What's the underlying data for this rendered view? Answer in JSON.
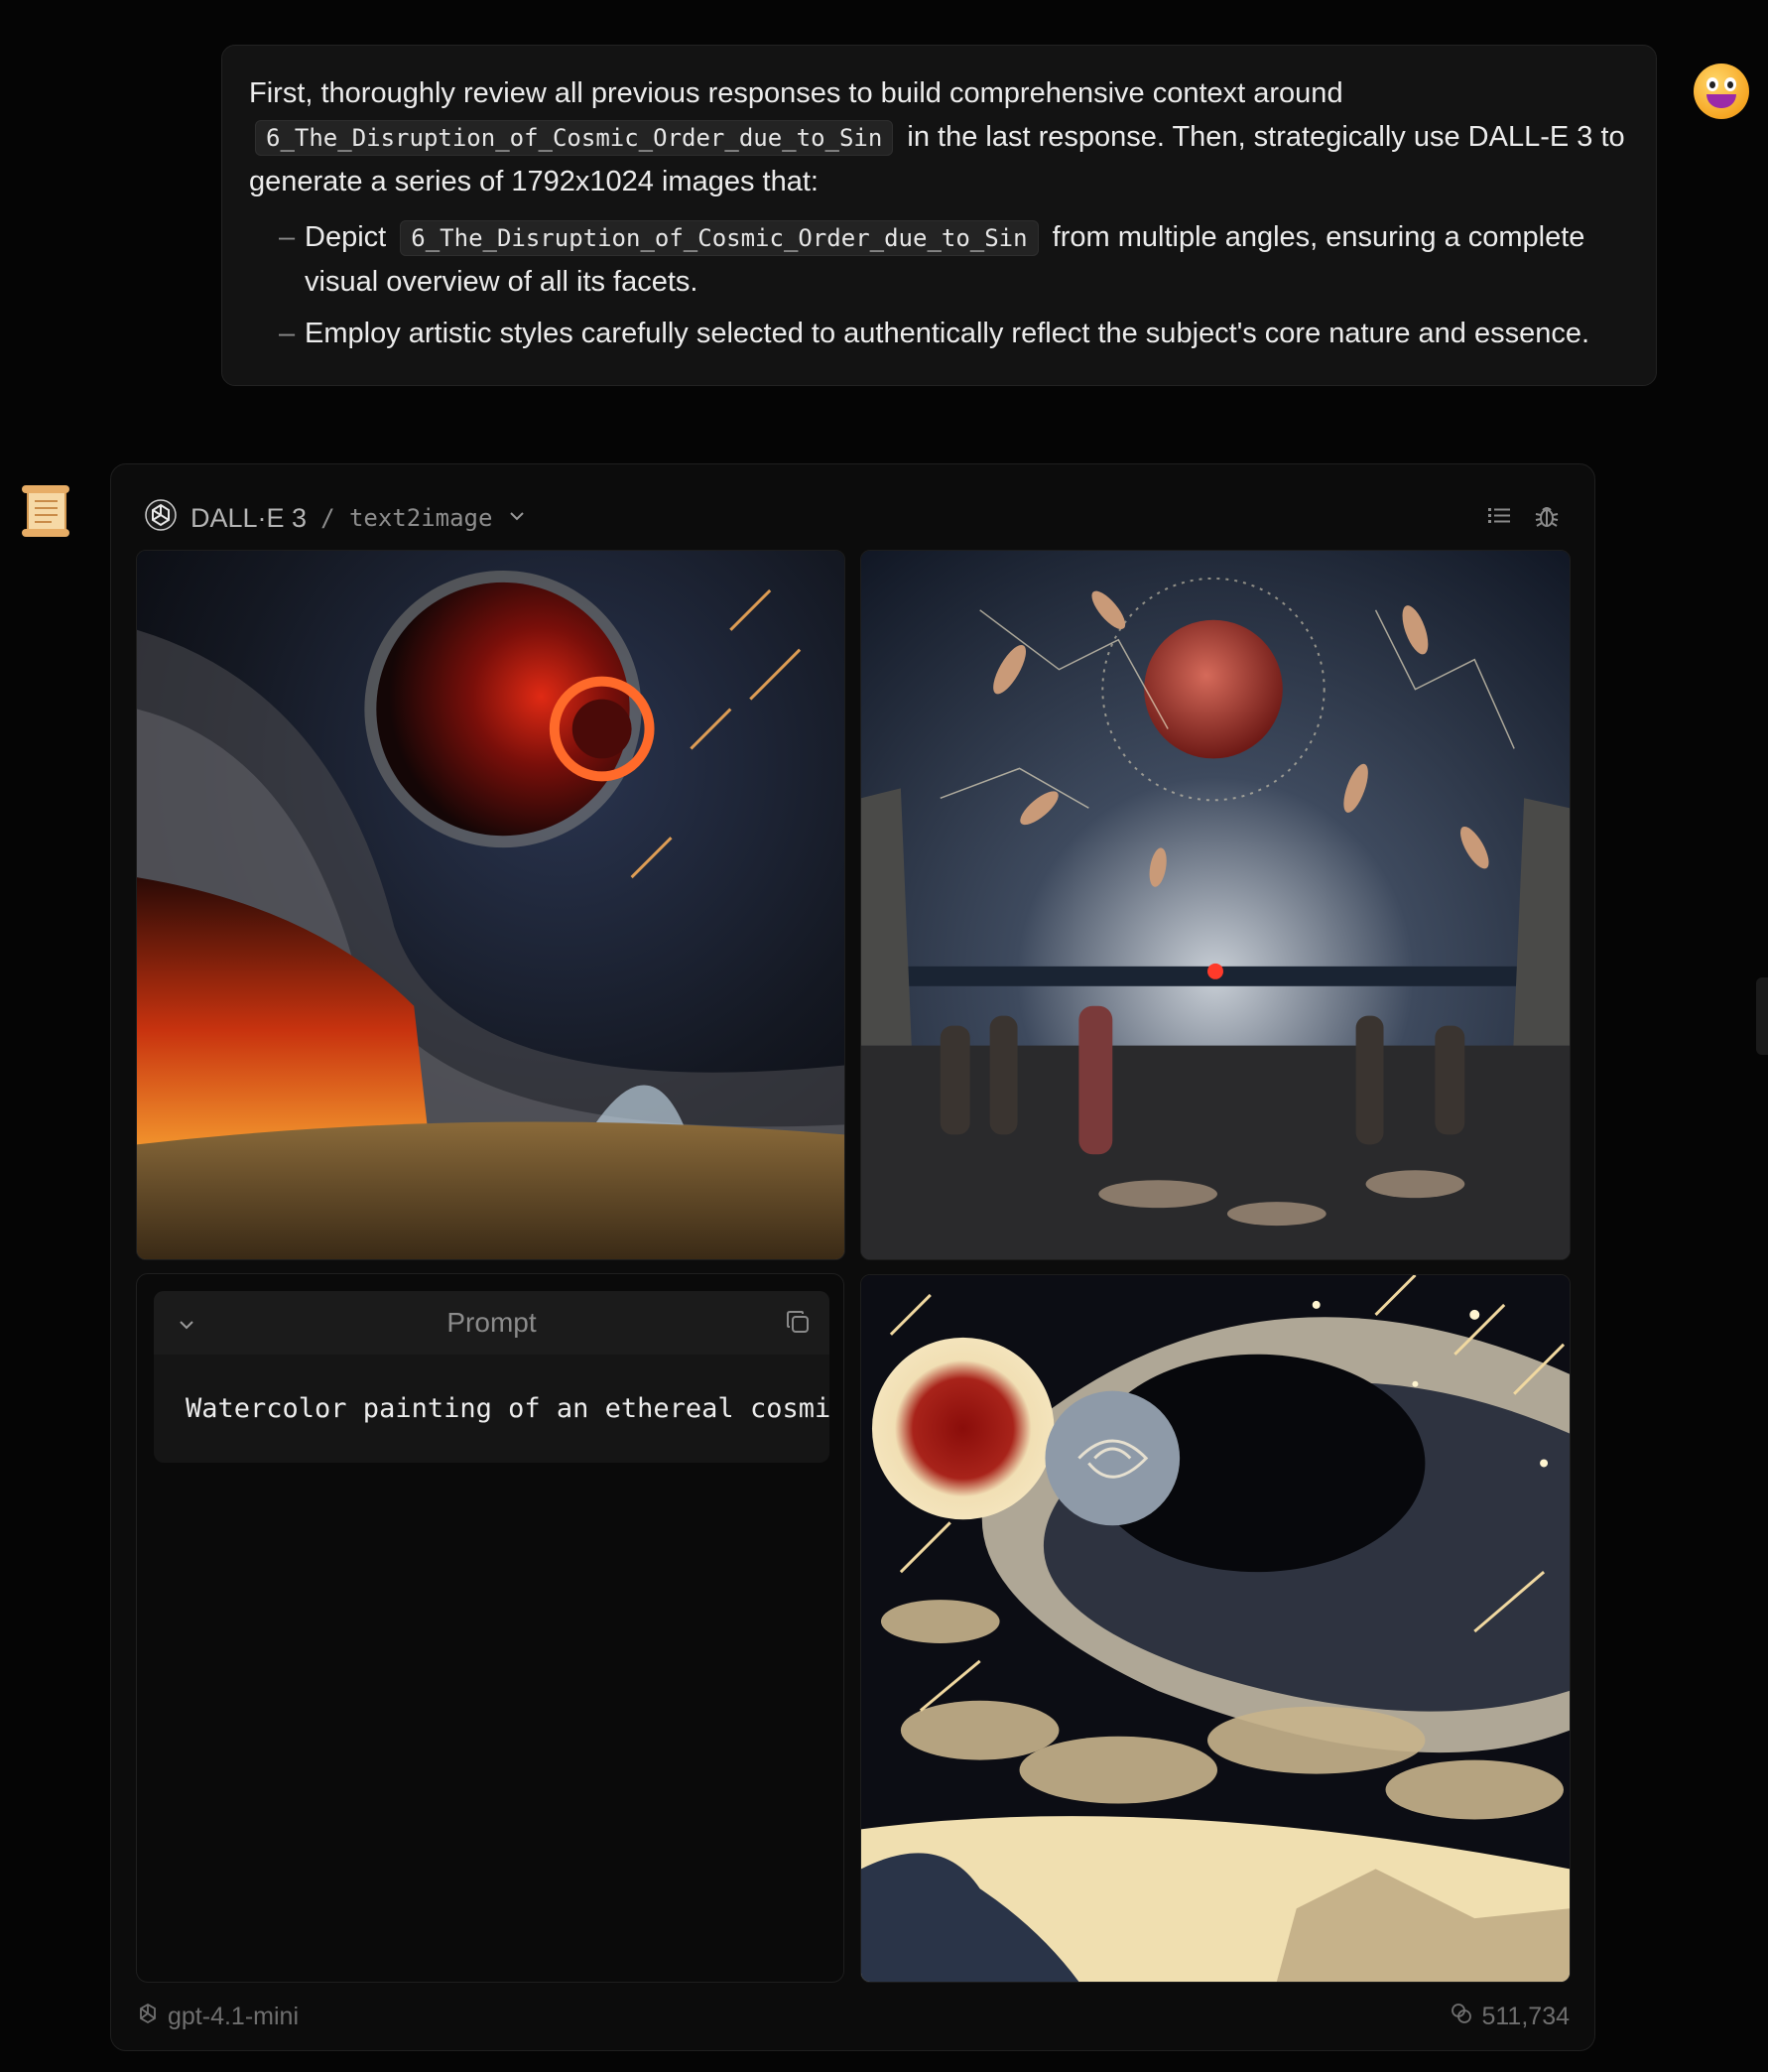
{
  "user_message": {
    "line1_prefix": "First, thoroughly review all previous responses to build comprehensive context around",
    "code_term": "6_The_Disruption_of_Cosmic_Order_due_to_Sin",
    "line2_suffix": "in the last response. Then, strategically use DALL-E 3 to generate a series of 1792x1024 images that:",
    "bullets": [
      {
        "prefix": "Depict",
        "code": "6_The_Disruption_of_Cosmic_Order_due_to_Sin",
        "suffix": "from multiple angles, ensuring a complete visual overview of all its facets."
      },
      {
        "text": "Employ artistic styles carefully selected to authentically reflect the subject's core nature and essence."
      }
    ]
  },
  "assistant": {
    "plugin": {
      "name": "DALL·E 3",
      "path": "/ text2image"
    },
    "prompt": {
      "title": "Prompt",
      "text": "Watercolor painting of an ethereal cosmic scene"
    },
    "footer": {
      "model": "gpt-4.1-mini",
      "tokens": "511,734"
    },
    "images": [
      {
        "name": "eclipsed-planet-storm"
      },
      {
        "name": "falling-figures-red-moon"
      },
      {
        "name": "ukiyoe-cosmic-wave"
      }
    ]
  },
  "colors": {
    "background": "#050505",
    "bubble": "#131313",
    "card": "#0c0c0c",
    "muted_text": "#8d8d8d"
  }
}
